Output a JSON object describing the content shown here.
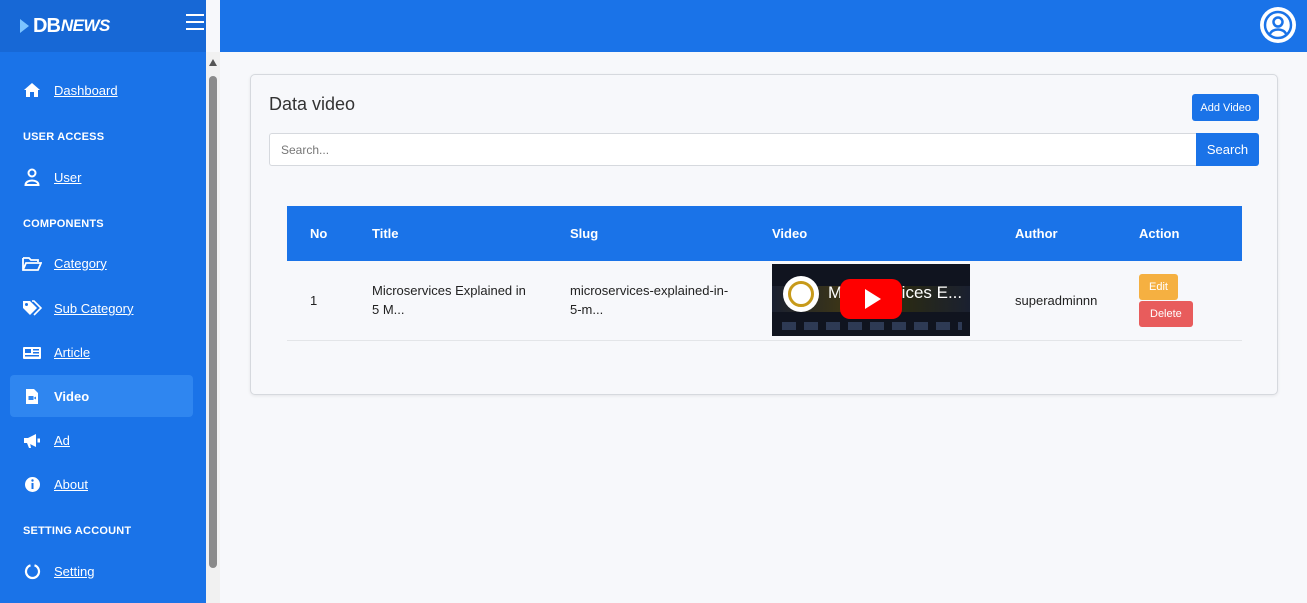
{
  "brand": {
    "logo_primary": "DB",
    "logo_secondary": "NEWS"
  },
  "sidebar": {
    "items": [
      {
        "label": "Dashboard",
        "icon": "home-icon"
      },
      {
        "label": "User",
        "icon": "user-icon"
      },
      {
        "label": "Category",
        "icon": "folder-open-icon"
      },
      {
        "label": "Sub Category",
        "icon": "tags-icon"
      },
      {
        "label": "Article",
        "icon": "newspaper-icon"
      },
      {
        "label": "Video",
        "icon": "file-video-icon",
        "active": true
      },
      {
        "label": "Ad",
        "icon": "bullhorn-icon"
      },
      {
        "label": "About",
        "icon": "info-circle-icon"
      },
      {
        "label": "Setting",
        "icon": "circle-notch-icon"
      }
    ],
    "headers": [
      "USER ACCESS",
      "COMPONENTS",
      "SETTING ACCOUNT"
    ]
  },
  "topbar": {
    "avatar_icon": "user-circle-icon"
  },
  "main": {
    "title": "Data video",
    "add_button": "Add Video",
    "search": {
      "placeholder": "Search...",
      "value": "",
      "button": "Search"
    },
    "table": {
      "columns": [
        "No",
        "Title",
        "Slug",
        "Video",
        "Author",
        "Action"
      ],
      "rows": [
        {
          "no": "1",
          "title": "Microservices Explained in 5 M...",
          "slug": "microservices-explained-in-5-m...",
          "video_thumb_text": "Microservices E...",
          "author": "superadminnn",
          "edit": "Edit",
          "delete": "Delete"
        }
      ]
    }
  },
  "colors": {
    "primary": "#1a73e8",
    "edit": "#f5b041",
    "delete": "#e85c5c",
    "play": "#ff0000"
  }
}
